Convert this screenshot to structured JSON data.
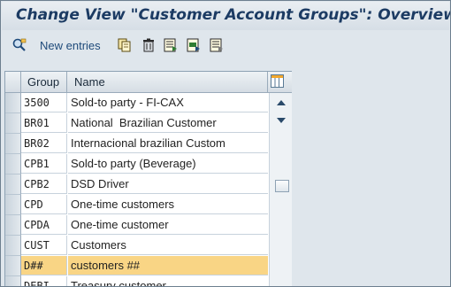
{
  "window": {
    "title": "Change View \"Customer Account Groups\": Overview"
  },
  "toolbar": {
    "new_entries_label": "New entries",
    "icons": [
      "display-change-icon",
      "copy-icon",
      "delete-icon",
      "select-all-icon",
      "select-block-icon",
      "deselect-all-icon"
    ]
  },
  "table": {
    "columns": {
      "group": "Group",
      "name": "Name"
    },
    "rows": [
      {
        "group": "3500",
        "name": "Sold-to party - FI-CAX"
      },
      {
        "group": "BR01",
        "name": "National  Brazilian Customer"
      },
      {
        "group": "BR02",
        "name": "Internacional brazilian Custom"
      },
      {
        "group": "CPB1",
        "name": "Sold-to party (Beverage)"
      },
      {
        "group": "CPB2",
        "name": "DSD Driver"
      },
      {
        "group": "CPD",
        "name": "One-time customers"
      },
      {
        "group": "CPDA",
        "name": "One-time customer"
      },
      {
        "group": "CUST",
        "name": "Customers"
      },
      {
        "group": "D##",
        "name": "customers ##"
      },
      {
        "group": "DEBI",
        "name": "Treasury customer"
      }
    ],
    "highlighted_row": "D##"
  },
  "colors": {
    "title": "#1c3b63",
    "highlight": "#f9d585",
    "background": "#dfe6ec"
  }
}
